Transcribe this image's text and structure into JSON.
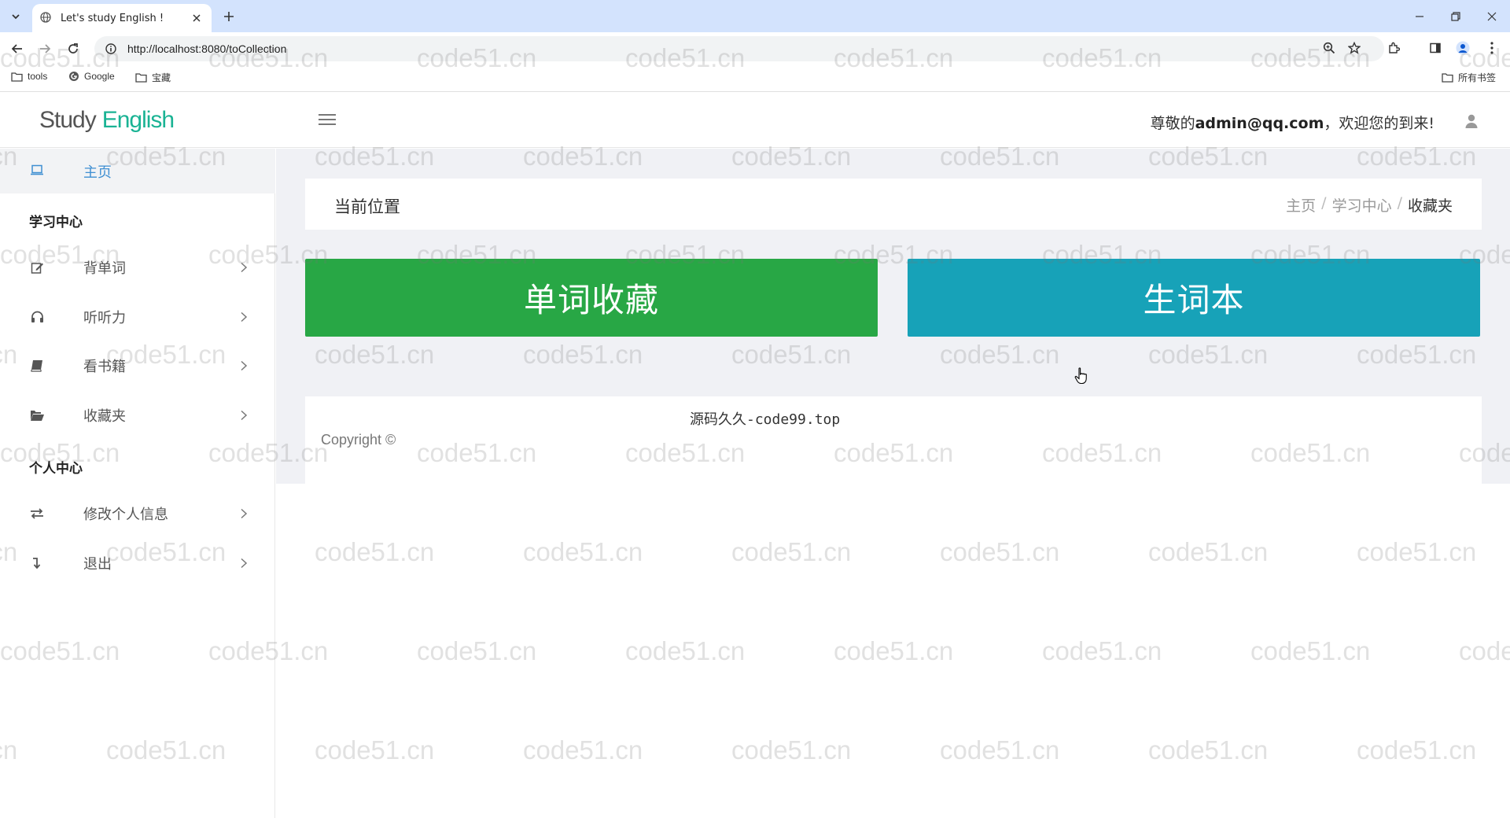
{
  "browser": {
    "tab_title": "Let's study English !",
    "url": "http://localhost:8080/toCollection",
    "bookmarks": [
      {
        "label": "tools",
        "icon": "folder-icon"
      },
      {
        "label": "Google",
        "icon": "google-icon"
      },
      {
        "label": "宝藏",
        "icon": "folder-icon"
      }
    ],
    "all_bookmarks_label": "所有书签"
  },
  "header": {
    "logo_word1": "Study",
    "logo_word2": "English",
    "welcome_prefix": "尊敬的",
    "welcome_email": "admin@qq.com",
    "welcome_suffix": "，欢迎您的到来!"
  },
  "sidebar": {
    "home_label": "主页",
    "sections": [
      {
        "title": "学习中心",
        "items": [
          {
            "label": "背单词",
            "icon": "edit-icon"
          },
          {
            "label": "听听力",
            "icon": "headphones-icon"
          },
          {
            "label": "看书籍",
            "icon": "book-icon"
          },
          {
            "label": "收藏夹",
            "icon": "folder-open-icon"
          }
        ]
      },
      {
        "title": "个人中心",
        "items": [
          {
            "label": "修改个人信息",
            "icon": "exchange-icon"
          },
          {
            "label": "退出",
            "icon": "level-down-icon"
          }
        ]
      }
    ]
  },
  "main": {
    "location_title": "当前位置",
    "breadcrumb": [
      "主页",
      "学习中心",
      "收藏夹"
    ],
    "word_collection_button": "单词收藏",
    "vocab_book_button": "生词本",
    "footer_source": "源码久久-code99.top",
    "footer_copyright": "Copyright ©"
  },
  "watermark_text": "code51.cn",
  "colors": {
    "accent_green": "#28a745",
    "accent_teal": "#17a2b8",
    "logo_green": "#1ab394",
    "home_link": "#3f8fd2"
  }
}
